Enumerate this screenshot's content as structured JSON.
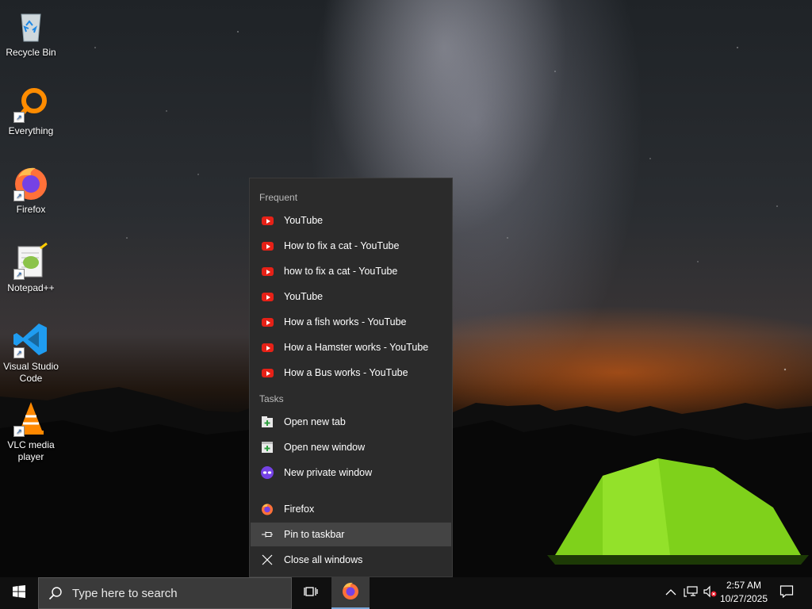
{
  "desktop": {
    "icons": [
      {
        "label": "Recycle Bin",
        "icon": "recycle-bin-icon"
      },
      {
        "label": "Everything",
        "icon": "everything-search-icon"
      },
      {
        "label": "Firefox",
        "icon": "firefox-icon"
      },
      {
        "label": "Notepad++",
        "icon": "notepad-plus-plus-icon"
      },
      {
        "label": "Visual Studio Code",
        "icon": "vscode-icon"
      },
      {
        "label": "VLC media player",
        "icon": "vlc-icon"
      }
    ]
  },
  "jumplist": {
    "frequent_header": "Frequent",
    "frequent": [
      {
        "label": "YouTube",
        "icon": "youtube-icon"
      },
      {
        "label": "How to fix a cat - YouTube",
        "icon": "youtube-icon"
      },
      {
        "label": "how to fix a cat - YouTube",
        "icon": "youtube-icon"
      },
      {
        "label": "YouTube",
        "icon": "youtube-icon"
      },
      {
        "label": "How a fish works - YouTube",
        "icon": "youtube-icon"
      },
      {
        "label": "How a Hamster works - YouTube",
        "icon": "youtube-icon"
      },
      {
        "label": "How a Bus works - YouTube",
        "icon": "youtube-icon"
      }
    ],
    "tasks_header": "Tasks",
    "tasks": [
      {
        "label": "Open new tab",
        "icon": "new-tab-icon"
      },
      {
        "label": "Open new window",
        "icon": "new-window-icon"
      },
      {
        "label": "New private window",
        "icon": "private-window-icon"
      }
    ],
    "app": {
      "label": "Firefox",
      "icon": "firefox-icon"
    },
    "pin": {
      "label": "Pin to taskbar",
      "icon": "pin-icon"
    },
    "close_all": {
      "label": "Close all windows",
      "icon": "close-icon"
    }
  },
  "taskbar": {
    "search_placeholder": "Type here to search",
    "clock_time": "2:57 AM",
    "clock_date": "10/27/2025"
  },
  "colors": {
    "youtube": "#e62117",
    "firefox_orange": "#ff7139",
    "firefox_purple": "#7542e5",
    "menu_bg": "#2b2b2b",
    "taskbar_bg": "#101010"
  }
}
